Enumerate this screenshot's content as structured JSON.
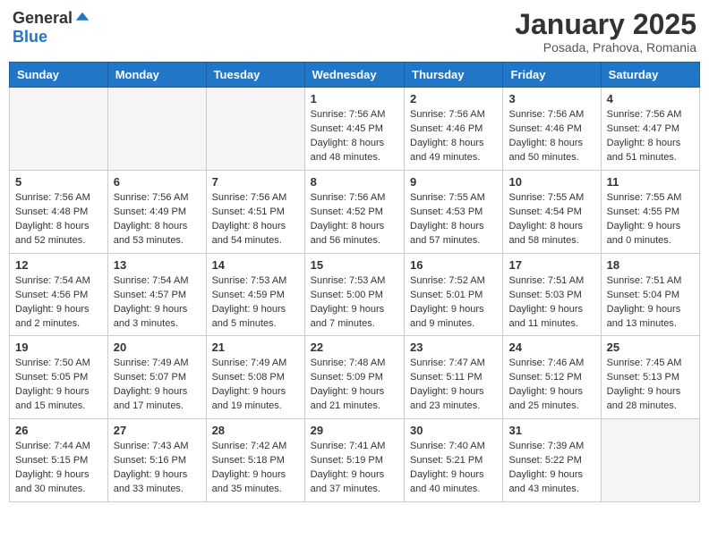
{
  "header": {
    "logo": {
      "general": "General",
      "blue": "Blue"
    },
    "title": "January 2025",
    "location": "Posada, Prahova, Romania"
  },
  "weekdays": [
    "Sunday",
    "Monday",
    "Tuesday",
    "Wednesday",
    "Thursday",
    "Friday",
    "Saturday"
  ],
  "weeks": [
    [
      {
        "day": "",
        "empty": true
      },
      {
        "day": "",
        "empty": true
      },
      {
        "day": "",
        "empty": true
      },
      {
        "day": "1",
        "sunrise": "7:56 AM",
        "sunset": "4:45 PM",
        "daylight": "8 hours and 48 minutes."
      },
      {
        "day": "2",
        "sunrise": "7:56 AM",
        "sunset": "4:46 PM",
        "daylight": "8 hours and 49 minutes."
      },
      {
        "day": "3",
        "sunrise": "7:56 AM",
        "sunset": "4:46 PM",
        "daylight": "8 hours and 50 minutes."
      },
      {
        "day": "4",
        "sunrise": "7:56 AM",
        "sunset": "4:47 PM",
        "daylight": "8 hours and 51 minutes."
      }
    ],
    [
      {
        "day": "5",
        "sunrise": "7:56 AM",
        "sunset": "4:48 PM",
        "daylight": "8 hours and 52 minutes."
      },
      {
        "day": "6",
        "sunrise": "7:56 AM",
        "sunset": "4:49 PM",
        "daylight": "8 hours and 53 minutes."
      },
      {
        "day": "7",
        "sunrise": "7:56 AM",
        "sunset": "4:51 PM",
        "daylight": "8 hours and 54 minutes."
      },
      {
        "day": "8",
        "sunrise": "7:56 AM",
        "sunset": "4:52 PM",
        "daylight": "8 hours and 56 minutes."
      },
      {
        "day": "9",
        "sunrise": "7:55 AM",
        "sunset": "4:53 PM",
        "daylight": "8 hours and 57 minutes."
      },
      {
        "day": "10",
        "sunrise": "7:55 AM",
        "sunset": "4:54 PM",
        "daylight": "8 hours and 58 minutes."
      },
      {
        "day": "11",
        "sunrise": "7:55 AM",
        "sunset": "4:55 PM",
        "daylight": "9 hours and 0 minutes."
      }
    ],
    [
      {
        "day": "12",
        "sunrise": "7:54 AM",
        "sunset": "4:56 PM",
        "daylight": "9 hours and 2 minutes."
      },
      {
        "day": "13",
        "sunrise": "7:54 AM",
        "sunset": "4:57 PM",
        "daylight": "9 hours and 3 minutes."
      },
      {
        "day": "14",
        "sunrise": "7:53 AM",
        "sunset": "4:59 PM",
        "daylight": "9 hours and 5 minutes."
      },
      {
        "day": "15",
        "sunrise": "7:53 AM",
        "sunset": "5:00 PM",
        "daylight": "9 hours and 7 minutes."
      },
      {
        "day": "16",
        "sunrise": "7:52 AM",
        "sunset": "5:01 PM",
        "daylight": "9 hours and 9 minutes."
      },
      {
        "day": "17",
        "sunrise": "7:51 AM",
        "sunset": "5:03 PM",
        "daylight": "9 hours and 11 minutes."
      },
      {
        "day": "18",
        "sunrise": "7:51 AM",
        "sunset": "5:04 PM",
        "daylight": "9 hours and 13 minutes."
      }
    ],
    [
      {
        "day": "19",
        "sunrise": "7:50 AM",
        "sunset": "5:05 PM",
        "daylight": "9 hours and 15 minutes."
      },
      {
        "day": "20",
        "sunrise": "7:49 AM",
        "sunset": "5:07 PM",
        "daylight": "9 hours and 17 minutes."
      },
      {
        "day": "21",
        "sunrise": "7:49 AM",
        "sunset": "5:08 PM",
        "daylight": "9 hours and 19 minutes."
      },
      {
        "day": "22",
        "sunrise": "7:48 AM",
        "sunset": "5:09 PM",
        "daylight": "9 hours and 21 minutes."
      },
      {
        "day": "23",
        "sunrise": "7:47 AM",
        "sunset": "5:11 PM",
        "daylight": "9 hours and 23 minutes."
      },
      {
        "day": "24",
        "sunrise": "7:46 AM",
        "sunset": "5:12 PM",
        "daylight": "9 hours and 25 minutes."
      },
      {
        "day": "25",
        "sunrise": "7:45 AM",
        "sunset": "5:13 PM",
        "daylight": "9 hours and 28 minutes."
      }
    ],
    [
      {
        "day": "26",
        "sunrise": "7:44 AM",
        "sunset": "5:15 PM",
        "daylight": "9 hours and 30 minutes."
      },
      {
        "day": "27",
        "sunrise": "7:43 AM",
        "sunset": "5:16 PM",
        "daylight": "9 hours and 33 minutes."
      },
      {
        "day": "28",
        "sunrise": "7:42 AM",
        "sunset": "5:18 PM",
        "daylight": "9 hours and 35 minutes."
      },
      {
        "day": "29",
        "sunrise": "7:41 AM",
        "sunset": "5:19 PM",
        "daylight": "9 hours and 37 minutes."
      },
      {
        "day": "30",
        "sunrise": "7:40 AM",
        "sunset": "5:21 PM",
        "daylight": "9 hours and 40 minutes."
      },
      {
        "day": "31",
        "sunrise": "7:39 AM",
        "sunset": "5:22 PM",
        "daylight": "9 hours and 43 minutes."
      },
      {
        "day": "",
        "empty": true
      }
    ]
  ]
}
